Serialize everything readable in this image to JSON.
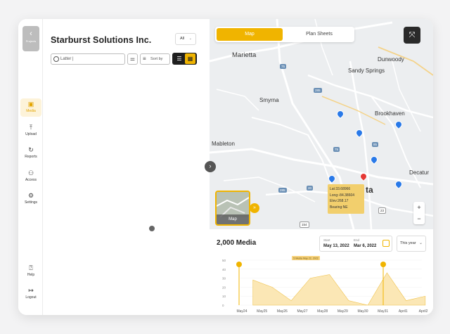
{
  "rail": {
    "back_label": "Projects",
    "items": [
      {
        "label": "Media",
        "icon": "media-icon",
        "active": true
      },
      {
        "label": "Upload",
        "icon": "upload-icon"
      },
      {
        "label": "Reports",
        "icon": "reports-icon"
      },
      {
        "label": "Access",
        "icon": "access-icon"
      },
      {
        "label": "Settings",
        "icon": "settings-icon"
      },
      {
        "label": "Help",
        "icon": "help-icon"
      },
      {
        "label": "Logout",
        "icon": "logout-icon"
      }
    ]
  },
  "panel": {
    "company": "Starburst Solutions Inc.",
    "filter_value": "All",
    "search_placeholder": "Latter |",
    "sort_label": "Sort by"
  },
  "map": {
    "tabs": [
      "Map",
      "Plan Sheets"
    ],
    "active_tab": "Map",
    "labels": [
      "Marietta",
      "Dunwoody",
      "Sandy Springs",
      "Smyrna",
      "Brookhaven",
      "Mableton",
      "Decatur",
      "ta"
    ],
    "highways": [
      "75",
      "285",
      "85",
      "75",
      "20",
      "285",
      "154",
      "23"
    ],
    "popup": {
      "lat": "Lat:33.68966",
      "long": "Long:-84.38604",
      "elev": "Elev:268.17",
      "bearing": "Bearing:NE"
    },
    "minimap_label": "Map",
    "zoom_in": "+",
    "zoom_out": "−",
    "accent": "#f0b400"
  },
  "media": {
    "count": "2,000 Media",
    "start_label": "Start",
    "start_value": "May 13, 2022",
    "end_label": "End",
    "end_value": "Mar 6, 2022",
    "range_value": "This year"
  },
  "chart_data": {
    "type": "area",
    "x": [
      "May24",
      "May25",
      "May26",
      "May27",
      "May28",
      "May29",
      "May30",
      "May31",
      "April1",
      "April2"
    ],
    "values": [
      null,
      28,
      20,
      5,
      30,
      34,
      5,
      0,
      36,
      5,
      10
    ],
    "yticks": [
      0,
      10,
      20,
      30,
      40,
      50
    ],
    "ylim": [
      0,
      50
    ],
    "annotation": "5 Media May 22, 2022"
  }
}
